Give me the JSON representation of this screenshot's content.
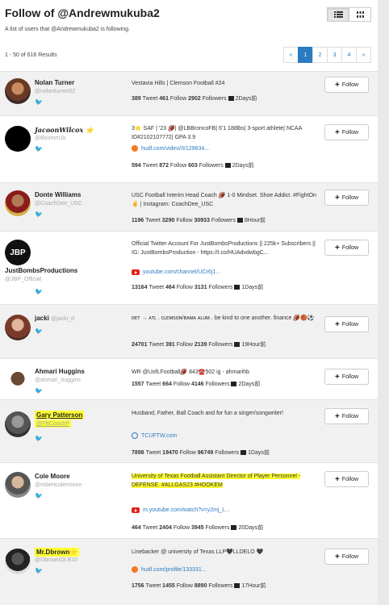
{
  "page": {
    "title": "Follow of @Andrewmukuba2",
    "subtitle": "A list of users that @Andrewmukuba2 is following.",
    "results": "1 - 50 of 616 Results",
    "view_toggle": [
      "list-view-icon",
      "grid-view-icon"
    ]
  },
  "pager": {
    "prev": "«",
    "pages": [
      "1",
      "2",
      "3",
      "4"
    ],
    "next": "»",
    "active": "1"
  },
  "follow_label": "Follow",
  "stat_labels": {
    "tweet": "Tweet",
    "follow": "Follow",
    "followers": "Followers"
  },
  "users": [
    {
      "name": "Nolan Turner",
      "handle": "@nolanturner02",
      "bio": "Vestavia Hills | Clemson Football #24",
      "link": "",
      "tweets": "389",
      "follows": "461",
      "followers": "2902",
      "ago": "2Days前"
    },
    {
      "name": "JacoonWilcox ⭐",
      "handle": "@Boomm1k",
      "bio": "3⭐ SAF | '23 🏈| @LBBroncoFB| 6'1 188lbs| 3-sport athlete| NCAA ID#2102107772| GPA 3.9",
      "link": "hudl.com/video/3/129834...",
      "tweets": "594",
      "follows": "872",
      "followers": "603",
      "ago": "2Days前"
    },
    {
      "name": "Donte Williams",
      "handle": "@CoachDee_USC",
      "bio": "USC Football Interim Head Coach 🏈 1-0 Mindset. Shoe Addict. #FightOn✌️ | Instagram: CoachDee_USC",
      "link": "",
      "tweets": "1196",
      "follows": "3290",
      "followers": "30933",
      "ago": "8Hour前"
    },
    {
      "name": "JustBombsProductions",
      "handle": "@JBP_Official",
      "bio": "Official Twitter Account For JustBombsProductions || 225k+ Subscribers || IG: JustBombsProduction - https://t.co/HUAdvdwbgC...",
      "link": "youtube.com/channel/UCr6j1...",
      "tweets": "13164",
      "follows": "464",
      "followers": "3131",
      "ago": "1Days前"
    },
    {
      "name": "jacki",
      "handle": "@jacki_d",
      "bio": "ᴅᴇᴛ → ᴀᴛʟ . ᴄʟᴇᴍsᴏɴ/ʙᴀᴍᴀ ᴀʟᴜᴍ . be kind to one another. finance 🏈🏀⚽",
      "link": "",
      "tweets": "24701",
      "follows": "391",
      "followers": "2139",
      "ago": "19Hour前"
    },
    {
      "name": "Ahmari Huggins",
      "handle": "@ahmari_huggins",
      "bio": "WR @UofLFootball🏈 843☎️502 ig - ahmarihb",
      "link": "",
      "tweets": "1557",
      "follows": "664",
      "followers": "4146",
      "ago": "2Days前"
    },
    {
      "name": "Gary Patterson",
      "handle": "@FBCoachP",
      "bio": "Husband, Father, Ball Coach and for fun a singer/songwriter!",
      "link": "TCUFTW.com",
      "tweets": "7898",
      "follows": "19470",
      "followers": "96749",
      "ago": "1Days前"
    },
    {
      "name": "Cole Moore",
      "handle": "@robertcolemoore",
      "bio": "University of Texas Football Assistant Director of Player Personnel - DEFENSE. #ALLGAS23 #HOOKEM",
      "link": "m.youtube.com/watch?v=y2mj_L...",
      "tweets": "464",
      "follows": "2404",
      "followers": "3945",
      "ago": "20Days前"
    },
    {
      "name": "Mr.Dbrown⭐",
      "handle": "@DbrownOLB10",
      "bio": "Linebacker @ university of Texas LLP🖤LLDELO 🖤",
      "link": "hudl.com/profile/133331...",
      "tweets": "1756",
      "follows": "1455",
      "followers": "8890",
      "ago": "17Hour前"
    }
  ],
  "colors": {
    "link": "#2a7bc0",
    "highlight": "#ffff33",
    "row_alt": "#f1f1f1",
    "scrollbar": "#e9e9ec"
  }
}
